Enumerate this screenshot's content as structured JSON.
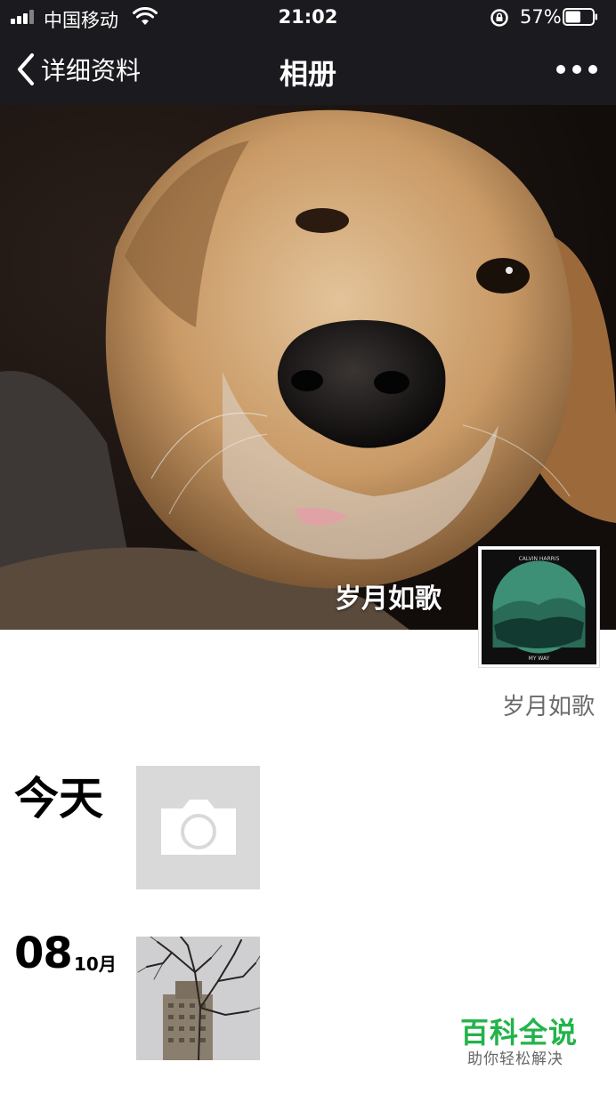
{
  "status_bar": {
    "carrier": "中国移动",
    "time": "21:02",
    "battery": "57%",
    "battery_level": 0.57
  },
  "nav": {
    "back_label": "详细资料",
    "title": "相册"
  },
  "cover": {
    "overlay_name": "岁月如歌",
    "album_art_title": "CALVIN HARRIS",
    "album_art_subtitle": "MY WAY"
  },
  "profile": {
    "name": "岁月如歌"
  },
  "timeline": {
    "today_label": "今天",
    "entry_day": "08",
    "entry_month": "10月"
  },
  "watermark": {
    "title": "百科全说",
    "subtitle": "助你轻松解决"
  },
  "colors": {
    "bar_bg": "#1b1b1f",
    "watermark_green": "#23b34a",
    "placeholder_gray": "#d9d9d9"
  }
}
